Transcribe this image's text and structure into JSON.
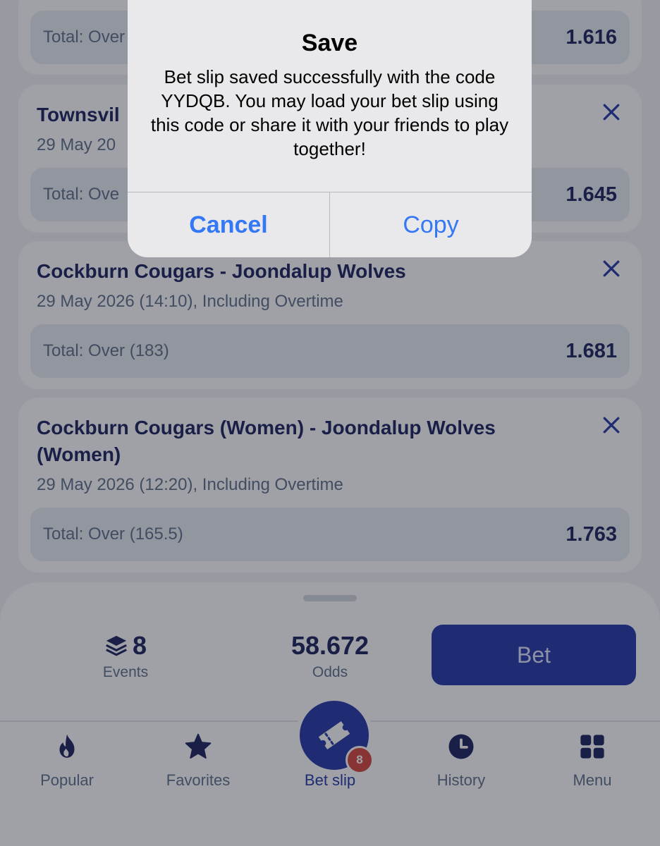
{
  "bets": [
    {
      "title": "",
      "date": "",
      "odds_label": "Total: Over",
      "odds_value": "1.616"
    },
    {
      "title": "Townsvil",
      "date": "29 May 20",
      "odds_label": "Total: Ove",
      "odds_value": "1.645"
    },
    {
      "title": "Cockburn Cougars - Joondalup Wolves",
      "date": "29 May 2026 (14:10), Including Overtime",
      "odds_label": "Total: Over (183)",
      "odds_value": "1.681"
    },
    {
      "title": "Cockburn Cougars (Women) - Joondalup Wolves (Women)",
      "date": "29 May 2026 (12:20), Including Overtime",
      "odds_label": "Total: Over (165.5)",
      "odds_value": "1.763"
    }
  ],
  "summary": {
    "events_count": "8",
    "events_label": "Events",
    "odds_value": "58.672",
    "odds_label": "Odds",
    "bet_label": "Bet"
  },
  "tabs": [
    {
      "label": "Popular",
      "icon": "flame-icon"
    },
    {
      "label": "Favorites",
      "icon": "star-icon"
    },
    {
      "label": "Bet slip",
      "icon": "ticket-icon",
      "badge": "8",
      "active": true
    },
    {
      "label": "History",
      "icon": "clock-icon"
    },
    {
      "label": "Menu",
      "icon": "grid-icon"
    }
  ],
  "alert": {
    "title": "Save",
    "message": "Bet slip saved successfully with the code YYDQB. You may load your bet slip using this code or share it with your friends to play together!",
    "cancel_label": "Cancel",
    "copy_label": "Copy"
  },
  "colors": {
    "brand": "#2435a6",
    "navy_text": "#1b1f5c",
    "muted_text": "#5f6f8a",
    "alert_button": "#3478f6",
    "badge": "#d8423b"
  }
}
